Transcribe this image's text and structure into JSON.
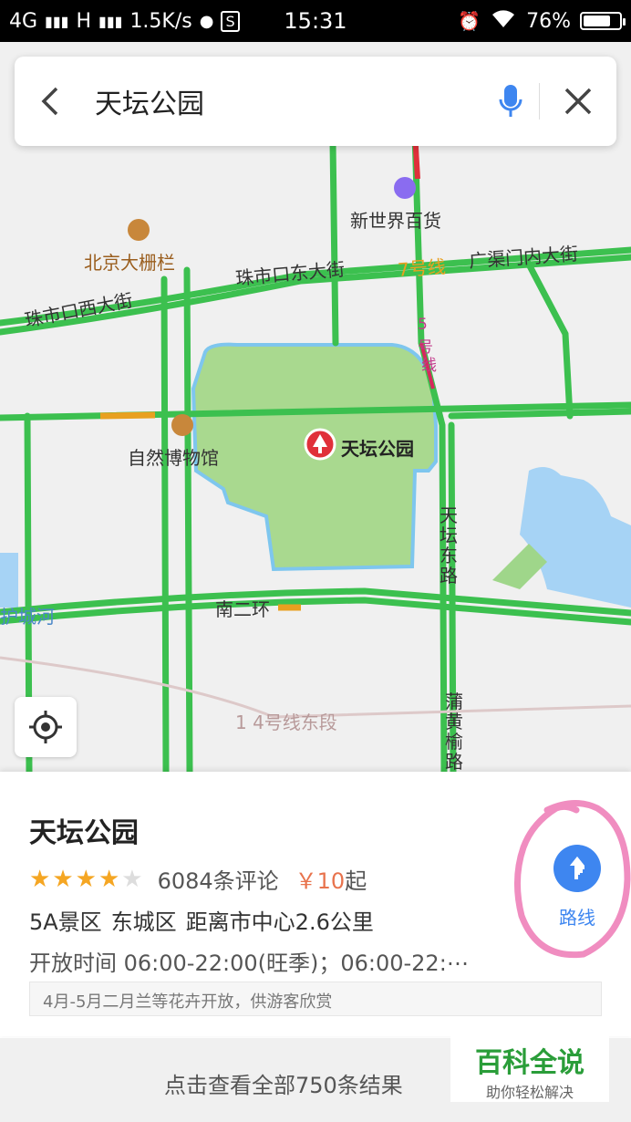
{
  "status_bar": {
    "network": "4G",
    "network2": "H",
    "speed": "1.5K/s",
    "time": "15:31",
    "battery": "76%",
    "battery_level": 0.76
  },
  "search": {
    "query": "天坛公园"
  },
  "map": {
    "labels": {
      "new_world": "新世界百货",
      "dashilan": "北京大栅栏",
      "zhushikou_east": "珠市口东大街",
      "line7": "7号线",
      "guangqumen": "广渠门内大街",
      "zhushikou_west": "珠市口西大街",
      "line5a": "5",
      "line5b": "号",
      "line5c": "线",
      "museum": "自然博物馆",
      "temple": "天坛公园",
      "tiantan_east": "天坛东路",
      "nan_erhuan": "南二环",
      "hucheng": "护城河",
      "line14": "1 4号线东段",
      "puhuang": "蒲黄榆路"
    }
  },
  "poi": {
    "name": "天坛公园",
    "rating": 4,
    "rating_max": 5,
    "reviews": "6084条评论",
    "price": "￥10",
    "price_suffix": "起",
    "level": "5A景区",
    "district": "东城区",
    "distance": "距离市中心2.6公里",
    "hours": "开放时间 06:00-22:00(旺季)；06:00-22:⋯",
    "notice": "4月-5月二月兰等花卉开放，供游客欣赏",
    "route_label": "路线"
  },
  "footer": {
    "more": "点击查看全部750条结果"
  },
  "watermark": {
    "main": "百科全说",
    "sub": "助你轻松解决"
  },
  "colors": {
    "road": "#3cc04f",
    "park": "#a9d98f",
    "water": "#a6d3f5",
    "accent": "#3e86f0",
    "price": "#e8734d",
    "star": "#f5a623",
    "annotation": "#f08dc0",
    "marker": "#e0303a"
  }
}
